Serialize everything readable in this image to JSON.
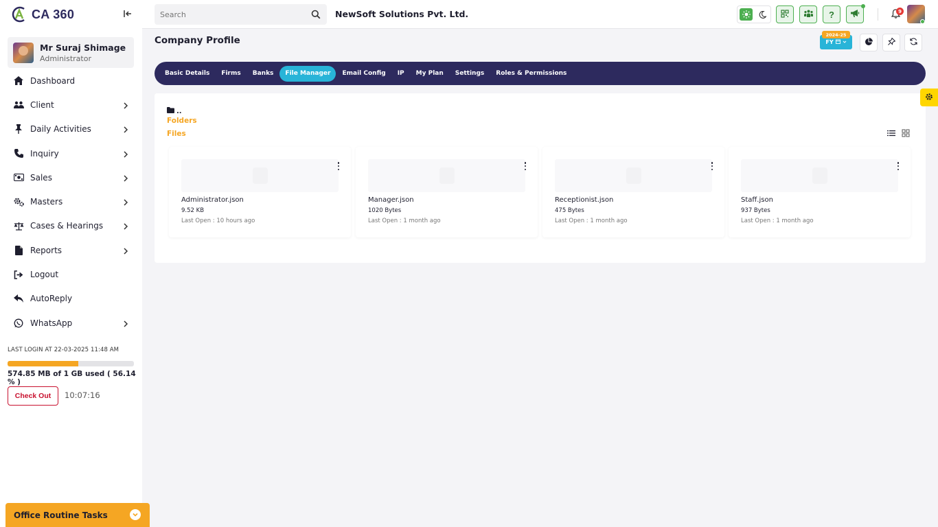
{
  "app": {
    "logo_text": "CA 360",
    "company_name": "NewSoft Solutions Pvt. Ltd."
  },
  "search": {
    "placeholder": "Search",
    "value": ""
  },
  "user": {
    "name": "Mr Suraj Shimage",
    "role": "Administrator"
  },
  "sidebar": {
    "items": [
      {
        "label": "Dashboard",
        "icon": "home-icon",
        "has_submenu": false
      },
      {
        "label": "Client",
        "icon": "users-icon",
        "has_submenu": true
      },
      {
        "label": "Daily Activities",
        "icon": "pin-icon",
        "has_submenu": true
      },
      {
        "label": "Inquiry",
        "icon": "phone-icon",
        "has_submenu": true
      },
      {
        "label": "Sales",
        "icon": "money-icon",
        "has_submenu": true
      },
      {
        "label": "Masters",
        "icon": "gears-icon",
        "has_submenu": true
      },
      {
        "label": "Cases & Hearings",
        "icon": "scale-icon",
        "has_submenu": true
      },
      {
        "label": "Reports",
        "icon": "file-icon",
        "has_submenu": true
      },
      {
        "label": "Logout",
        "icon": "logout-icon",
        "has_submenu": false
      },
      {
        "label": "AutoReply",
        "icon": "reply-icon",
        "has_submenu": false
      },
      {
        "label": "WhatsApp",
        "icon": "whatsapp-icon",
        "has_submenu": true
      }
    ],
    "last_login": "LAST LOGIN AT 22-03-2025 11:48 AM",
    "storage_text": "574.85 MB of 1 GB used ( 56.14 % )",
    "storage_percent": 56.14,
    "checkout_label": "Check Out",
    "clock": "10:07:16",
    "routine_label": "Office Routine Tasks"
  },
  "topbar": {
    "notification_count": "9"
  },
  "header": {
    "page_title": "Company Profile",
    "fy_label": "FY",
    "fy_year": "2024-25"
  },
  "tabs": [
    {
      "label": "Basic Details",
      "active": false
    },
    {
      "label": "Firms",
      "active": false
    },
    {
      "label": "Banks",
      "active": false
    },
    {
      "label": "File Manager",
      "active": true
    },
    {
      "label": "Email Config",
      "active": false
    },
    {
      "label": "IP",
      "active": false
    },
    {
      "label": "My Plan",
      "active": false
    },
    {
      "label": "Settings",
      "active": false
    },
    {
      "label": "Roles & Permissions",
      "active": false
    }
  ],
  "file_manager": {
    "breadcrumb": "..",
    "folders_label": "Folders",
    "files_label": "Files",
    "files": [
      {
        "name": "Administrator.json",
        "size": "9.52 KB",
        "last_open": "Last Open : 10 hours ago"
      },
      {
        "name": "Manager.json",
        "size": "1020 Bytes",
        "last_open": "Last Open : 1 month ago"
      },
      {
        "name": "Receptionist.json",
        "size": "475 Bytes",
        "last_open": "Last Open : 1 month ago"
      },
      {
        "name": "Staff.json",
        "size": "937 Bytes",
        "last_open": "Last Open : 1 month ago"
      }
    ]
  },
  "colors": {
    "primary": "#2d2a5e",
    "accent": "#28b4d8",
    "orange": "#f5a623",
    "green": "#4caf50",
    "danger": "#c8102e"
  }
}
